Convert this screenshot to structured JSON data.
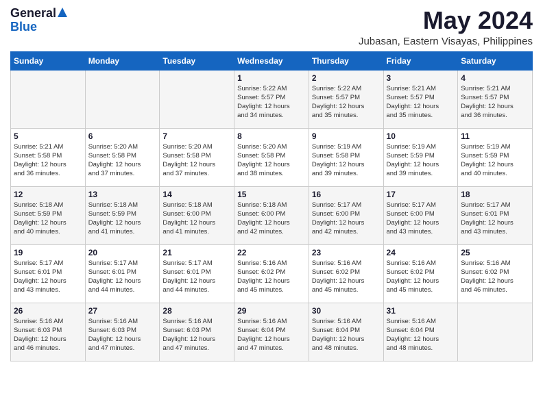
{
  "header": {
    "logo_general": "General",
    "logo_blue": "Blue",
    "title": "May 2024",
    "subtitle": "Jubasan, Eastern Visayas, Philippines"
  },
  "weekdays": [
    "Sunday",
    "Monday",
    "Tuesday",
    "Wednesday",
    "Thursday",
    "Friday",
    "Saturday"
  ],
  "weeks": [
    [
      {
        "day": "",
        "details": ""
      },
      {
        "day": "",
        "details": ""
      },
      {
        "day": "",
        "details": ""
      },
      {
        "day": "1",
        "details": "Sunrise: 5:22 AM\nSunset: 5:57 PM\nDaylight: 12 hours\nand 34 minutes."
      },
      {
        "day": "2",
        "details": "Sunrise: 5:22 AM\nSunset: 5:57 PM\nDaylight: 12 hours\nand 35 minutes."
      },
      {
        "day": "3",
        "details": "Sunrise: 5:21 AM\nSunset: 5:57 PM\nDaylight: 12 hours\nand 35 minutes."
      },
      {
        "day": "4",
        "details": "Sunrise: 5:21 AM\nSunset: 5:57 PM\nDaylight: 12 hours\nand 36 minutes."
      }
    ],
    [
      {
        "day": "5",
        "details": "Sunrise: 5:21 AM\nSunset: 5:58 PM\nDaylight: 12 hours\nand 36 minutes."
      },
      {
        "day": "6",
        "details": "Sunrise: 5:20 AM\nSunset: 5:58 PM\nDaylight: 12 hours\nand 37 minutes."
      },
      {
        "day": "7",
        "details": "Sunrise: 5:20 AM\nSunset: 5:58 PM\nDaylight: 12 hours\nand 37 minutes."
      },
      {
        "day": "8",
        "details": "Sunrise: 5:20 AM\nSunset: 5:58 PM\nDaylight: 12 hours\nand 38 minutes."
      },
      {
        "day": "9",
        "details": "Sunrise: 5:19 AM\nSunset: 5:58 PM\nDaylight: 12 hours\nand 39 minutes."
      },
      {
        "day": "10",
        "details": "Sunrise: 5:19 AM\nSunset: 5:59 PM\nDaylight: 12 hours\nand 39 minutes."
      },
      {
        "day": "11",
        "details": "Sunrise: 5:19 AM\nSunset: 5:59 PM\nDaylight: 12 hours\nand 40 minutes."
      }
    ],
    [
      {
        "day": "12",
        "details": "Sunrise: 5:18 AM\nSunset: 5:59 PM\nDaylight: 12 hours\nand 40 minutes."
      },
      {
        "day": "13",
        "details": "Sunrise: 5:18 AM\nSunset: 5:59 PM\nDaylight: 12 hours\nand 41 minutes."
      },
      {
        "day": "14",
        "details": "Sunrise: 5:18 AM\nSunset: 6:00 PM\nDaylight: 12 hours\nand 41 minutes."
      },
      {
        "day": "15",
        "details": "Sunrise: 5:18 AM\nSunset: 6:00 PM\nDaylight: 12 hours\nand 42 minutes."
      },
      {
        "day": "16",
        "details": "Sunrise: 5:17 AM\nSunset: 6:00 PM\nDaylight: 12 hours\nand 42 minutes."
      },
      {
        "day": "17",
        "details": "Sunrise: 5:17 AM\nSunset: 6:00 PM\nDaylight: 12 hours\nand 43 minutes."
      },
      {
        "day": "18",
        "details": "Sunrise: 5:17 AM\nSunset: 6:01 PM\nDaylight: 12 hours\nand 43 minutes."
      }
    ],
    [
      {
        "day": "19",
        "details": "Sunrise: 5:17 AM\nSunset: 6:01 PM\nDaylight: 12 hours\nand 43 minutes."
      },
      {
        "day": "20",
        "details": "Sunrise: 5:17 AM\nSunset: 6:01 PM\nDaylight: 12 hours\nand 44 minutes."
      },
      {
        "day": "21",
        "details": "Sunrise: 5:17 AM\nSunset: 6:01 PM\nDaylight: 12 hours\nand 44 minutes."
      },
      {
        "day": "22",
        "details": "Sunrise: 5:16 AM\nSunset: 6:02 PM\nDaylight: 12 hours\nand 45 minutes."
      },
      {
        "day": "23",
        "details": "Sunrise: 5:16 AM\nSunset: 6:02 PM\nDaylight: 12 hours\nand 45 minutes."
      },
      {
        "day": "24",
        "details": "Sunrise: 5:16 AM\nSunset: 6:02 PM\nDaylight: 12 hours\nand 45 minutes."
      },
      {
        "day": "25",
        "details": "Sunrise: 5:16 AM\nSunset: 6:02 PM\nDaylight: 12 hours\nand 46 minutes."
      }
    ],
    [
      {
        "day": "26",
        "details": "Sunrise: 5:16 AM\nSunset: 6:03 PM\nDaylight: 12 hours\nand 46 minutes."
      },
      {
        "day": "27",
        "details": "Sunrise: 5:16 AM\nSunset: 6:03 PM\nDaylight: 12 hours\nand 47 minutes."
      },
      {
        "day": "28",
        "details": "Sunrise: 5:16 AM\nSunset: 6:03 PM\nDaylight: 12 hours\nand 47 minutes."
      },
      {
        "day": "29",
        "details": "Sunrise: 5:16 AM\nSunset: 6:04 PM\nDaylight: 12 hours\nand 47 minutes."
      },
      {
        "day": "30",
        "details": "Sunrise: 5:16 AM\nSunset: 6:04 PM\nDaylight: 12 hours\nand 48 minutes."
      },
      {
        "day": "31",
        "details": "Sunrise: 5:16 AM\nSunset: 6:04 PM\nDaylight: 12 hours\nand 48 minutes."
      },
      {
        "day": "",
        "details": ""
      }
    ]
  ]
}
